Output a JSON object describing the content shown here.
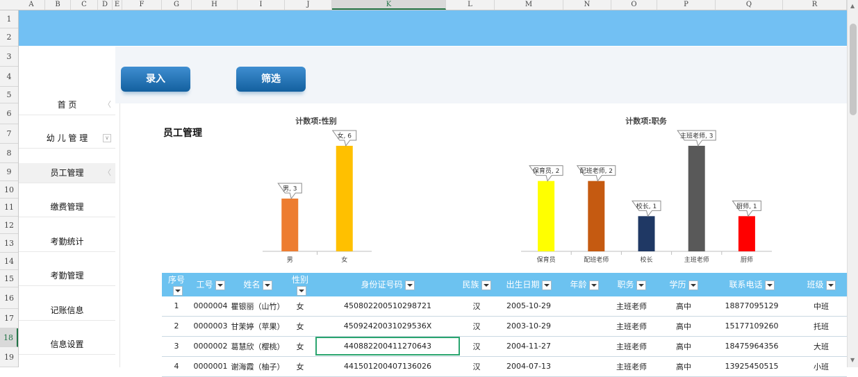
{
  "columns": [
    "A",
    "B",
    "C",
    "D",
    "E",
    "F",
    "G",
    "H",
    "I",
    "J",
    "K",
    "L",
    "M",
    "N",
    "O",
    "P",
    "Q",
    "R"
  ],
  "rows": [
    "1",
    "2",
    "3",
    "4",
    "5",
    "6",
    "7",
    "8",
    "9",
    "10",
    "11",
    "12",
    "13",
    "14",
    "15",
    "16",
    "17",
    "18",
    "19"
  ],
  "selected_column": "K",
  "selected_row": "18",
  "nav": {
    "home": "首 页",
    "kids": "幼 儿 管 理",
    "staff": "员工管理",
    "fees": "缴费管理",
    "attendance_stats": "考勤统计",
    "attendance_mgmt": "考勤管理",
    "accounting": "记账信息",
    "settings": "信息设置"
  },
  "buttons": {
    "entry": "录入",
    "filter": "筛选"
  },
  "page_title": "员工管理",
  "chart_data": [
    {
      "type": "bar",
      "title": "计数项:性别",
      "categories": [
        "男",
        "女"
      ],
      "values": [
        3,
        6
      ],
      "data_labels": [
        "男, 3",
        "女, 6"
      ],
      "colors": [
        "#ed7d31",
        "#ffc000"
      ]
    },
    {
      "type": "bar",
      "title": "计数项:职务",
      "categories": [
        "保育员",
        "配班老师",
        "校长",
        "主班老师",
        "厨师"
      ],
      "values": [
        2,
        2,
        1,
        3,
        1
      ],
      "data_labels": [
        "保育员, 2",
        "配班老师, 2",
        "校长, 1",
        "主班老师, 3",
        "厨师, 1"
      ],
      "colors": [
        "#ffff00",
        "#c55a11",
        "#1f3864",
        "#595959",
        "#ff0000"
      ]
    }
  ],
  "table": {
    "headers": [
      "序号",
      "工号",
      "姓名",
      "性别",
      "身份证号码",
      "民族",
      "出生日期",
      "年龄",
      "职务",
      "学历",
      "联系电话",
      "班级"
    ],
    "rows": [
      [
        "1",
        "0000004",
        "瞿银丽（山竹）",
        "女",
        "450802200510298721",
        "汉",
        "2005-10-29",
        "",
        "主班老师",
        "高中",
        "18877095129",
        "中班"
      ],
      [
        "2",
        "0000003",
        "甘茉婷（苹果）",
        "女",
        "45092420031029536X",
        "汉",
        "2003-10-29",
        "",
        "主班老师",
        "高中",
        "15177109260",
        "托班"
      ],
      [
        "3",
        "0000002",
        "葛慧欣（樱桃）",
        "女",
        "440882200411270643",
        "汉",
        "2004-11-27",
        "",
        "主班老师",
        "高中",
        "18475964356",
        "大班"
      ],
      [
        "4",
        "0000001",
        "谢海霞（柚子）",
        "女",
        "441501200407136026",
        "汉",
        "2004-07-13",
        "",
        "主班老师",
        "高中",
        "13925450515",
        "小班"
      ]
    ]
  }
}
